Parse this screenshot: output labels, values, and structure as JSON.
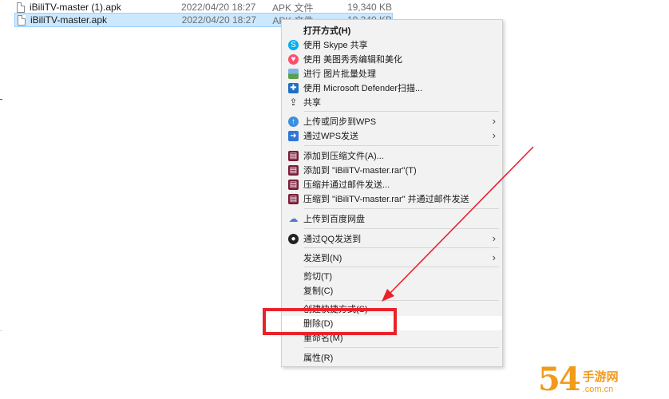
{
  "files": [
    {
      "name": "iBiliTV-master (1).apk",
      "date": "2022/04/20 18:27",
      "type": "APK 文件",
      "size": "19,340 KB",
      "selected": false
    },
    {
      "name": "iBiliTV-master.apk",
      "date": "2022/04/20 18:27",
      "type": "APK 文件",
      "size": "19,340 KB",
      "selected": true
    }
  ],
  "menu": {
    "open_with": "打开方式(H)",
    "skype_share": "使用 Skype 共享",
    "meitu": "使用 美图秀秀编辑和美化",
    "batch_image": "进行 图片批量处理",
    "defender": "使用 Microsoft Defender扫描...",
    "share": "共享",
    "wps_upload": "上传或同步到WPS",
    "wps_send": "通过WPS发送",
    "add_archive": "添加到压缩文件(A)...",
    "add_rar": "添加到 \"iBiliTV-master.rar\"(T)",
    "compress_email": "压缩并通过邮件发送...",
    "compress_rar_email": "压缩到 \"iBiliTV-master.rar\" 并通过邮件发送",
    "baidu_upload": "上传到百度网盘",
    "qq_send": "通过QQ发送到",
    "send_to": "发送到(N)",
    "cut": "剪切(T)",
    "copy": "复制(C)",
    "create_shortcut": "创建快捷方式(S)",
    "delete": "删除(D)",
    "rename": "重命名(M)",
    "properties": "属性(R)"
  },
  "icons": {
    "skype": "skype-icon",
    "meitu": "meitu-icon",
    "image": "image-batch-icon",
    "defender": "defender-shield-icon",
    "share": "share-icon",
    "cloud": "cloud-upload-icon",
    "wps": "wps-send-icon",
    "winrar": "winrar-icon",
    "baidu": "baidu-netdisk-icon",
    "qq": "qq-icon"
  },
  "colors": {
    "highlight": "#e8232b",
    "selection": "#cce8ff",
    "menu_bg": "#f2f2f2"
  },
  "watermark": {
    "big": "54",
    "cn": "手游网",
    "url": ".com.cn"
  }
}
